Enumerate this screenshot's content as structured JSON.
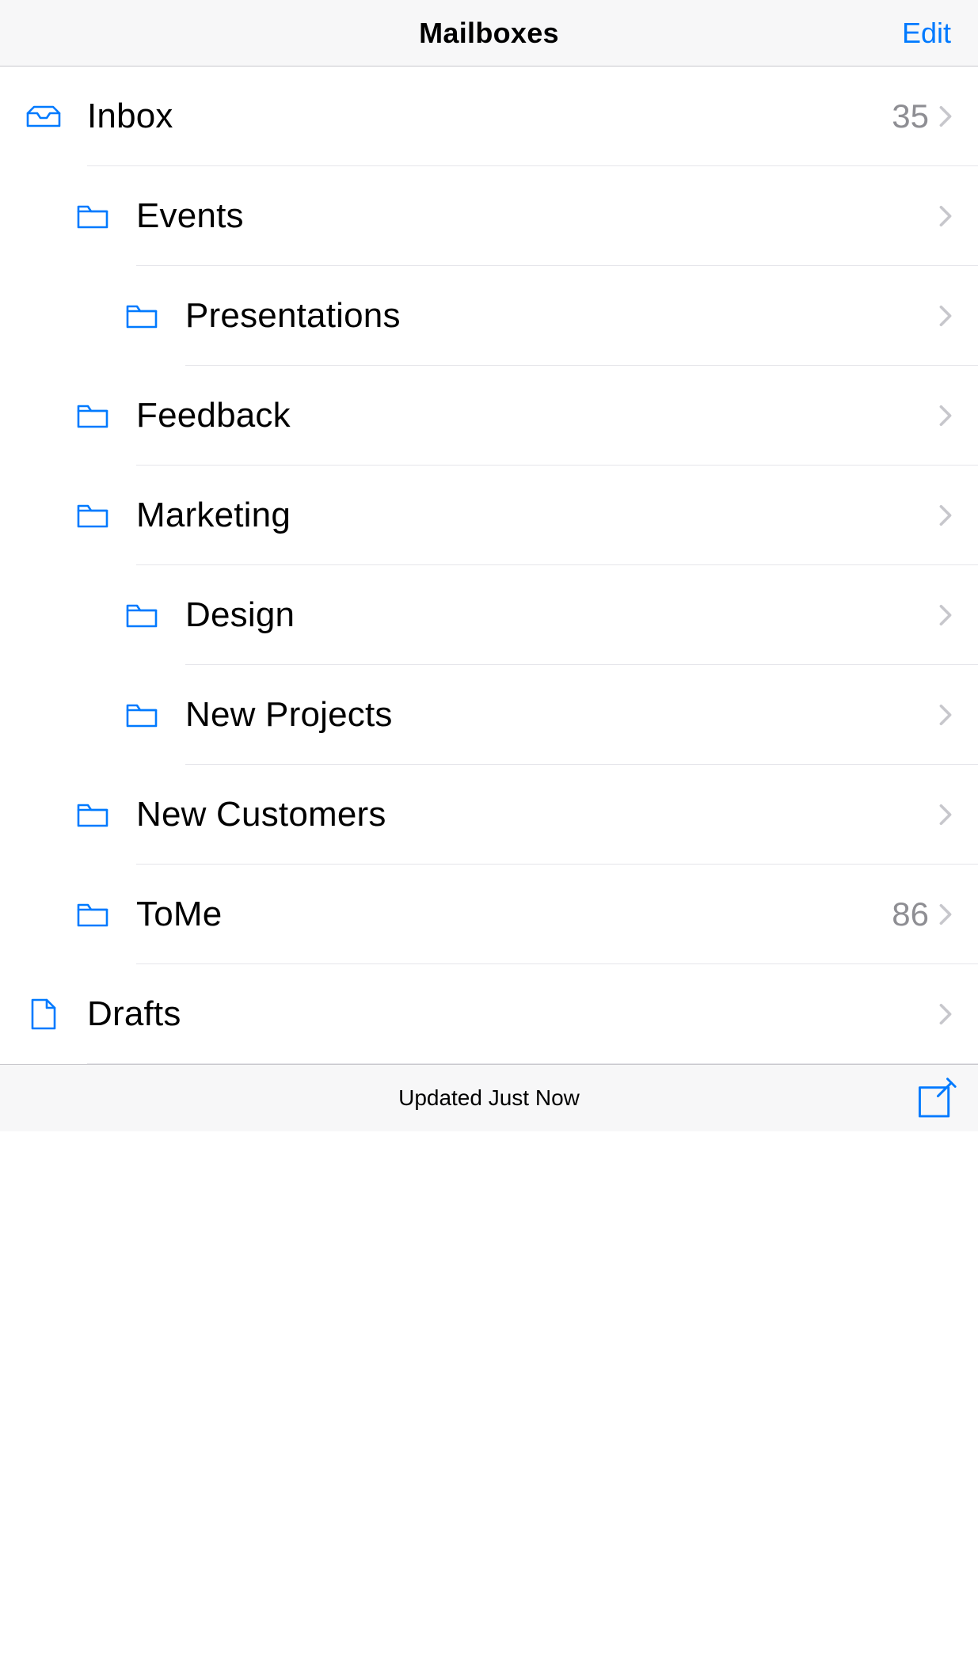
{
  "header": {
    "title": "Mailboxes",
    "editLabel": "Edit"
  },
  "rows": [
    {
      "id": "inbox",
      "icon": "inbox",
      "level": 0,
      "label": "Inbox",
      "count": "35",
      "sepLevel": 0
    },
    {
      "id": "events",
      "icon": "folder",
      "level": 1,
      "label": "Events",
      "count": "",
      "sepLevel": 1
    },
    {
      "id": "presentations",
      "icon": "folder",
      "level": 2,
      "label": "Presentations",
      "count": "",
      "sepLevel": 2
    },
    {
      "id": "feedback",
      "icon": "folder",
      "level": 1,
      "label": "Feedback",
      "count": "",
      "sepLevel": 1
    },
    {
      "id": "marketing",
      "icon": "folder",
      "level": 1,
      "label": "Marketing",
      "count": "",
      "sepLevel": 1
    },
    {
      "id": "design",
      "icon": "folder",
      "level": 2,
      "label": "Design",
      "count": "",
      "sepLevel": 2
    },
    {
      "id": "newprojects",
      "icon": "folder",
      "level": 2,
      "label": "New Projects",
      "count": "",
      "sepLevel": 2
    },
    {
      "id": "newcustomers",
      "icon": "folder",
      "level": 1,
      "label": "New Customers",
      "count": "",
      "sepLevel": 1
    },
    {
      "id": "tome",
      "icon": "folder",
      "level": 1,
      "label": "ToMe",
      "count": "86",
      "sepLevel": 1
    },
    {
      "id": "drafts",
      "icon": "drafts",
      "level": 0,
      "label": "Drafts",
      "count": "",
      "sepLevel": 0
    }
  ],
  "toolbar": {
    "status": "Updated Just Now"
  },
  "colors": {
    "accent": "#007aff",
    "secondaryText": "#8e8e93",
    "separator": "#e5e5ea",
    "barBackground": "#f7f7f8"
  }
}
